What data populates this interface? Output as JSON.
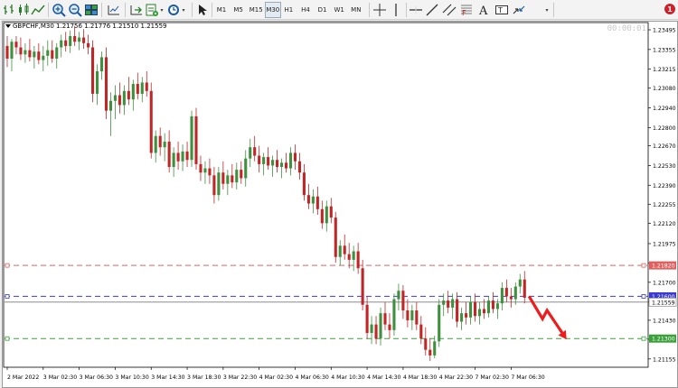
{
  "toolbar": {
    "timeframes": [
      "M1",
      "M5",
      "M15",
      "M30",
      "H1",
      "H4",
      "D1",
      "W1",
      "MN"
    ],
    "active_timeframe": "M30",
    "notification_count": "1",
    "icons": [
      "bar-chart-icon",
      "candlestick-icon",
      "line-chart-icon",
      "zoom-in-icon",
      "zoom-out-icon",
      "tile-windows-icon",
      "chart-shift-icon",
      "autoscroll-icon",
      "templates-icon",
      "periods-icon",
      "cursor-icon",
      "crosshair-icon",
      "vertical-line-icon",
      "horizontal-line-icon",
      "trendline-icon",
      "equidistant-channel-icon",
      "fibonacci-icon",
      "text-icon",
      "text-label-icon",
      "arrows-icon"
    ]
  },
  "chart": {
    "title": "GBPCHF,M30  1.21756 1.21776 1.21510 1.21559",
    "timer": "00:00:01"
  },
  "chart_data": {
    "type": "candlestick",
    "symbol": "GBPCHF",
    "timeframe": "M30",
    "ylim": [
      1.21096,
      1.2354
    ],
    "yticks": [
      1.23495,
      1.23355,
      1.23215,
      1.2308,
      1.2294,
      1.228,
      1.2267,
      1.2253,
      1.2239,
      1.22255,
      1.2212,
      1.21975,
      1.21835,
      1.217,
      1.2156,
      1.2143,
      1.21295,
      1.21155
    ],
    "ytick_labels": [
      "1.23495",
      "1.23355",
      "1.23215",
      "1.23080",
      "1.22940",
      "1.22800",
      "1.22670",
      "1.22530",
      "1.22390",
      "1.22255",
      "1.22120",
      "1.21975",
      "1.21835",
      "1.21700",
      "1.21560",
      "1.21430",
      "1.21295",
      "1.21155"
    ],
    "xtick_labels": [
      "2 Mar 2022",
      "3 Mar 02:30",
      "3 Mar 06:30",
      "3 Mar 10:30",
      "3 Mar 14:30",
      "3 Mar 18:30",
      "3 Mar 22:30",
      "4 Mar 02:30",
      "4 Mar 06:30",
      "4 Mar 10:30",
      "4 Mar 14:30",
      "4 Mar 18:30",
      "4 Mar 22:30",
      "7 Mar 02:30",
      "7 Mar 06:30"
    ],
    "xtick_bar_index": [
      0,
      8,
      16,
      24,
      32,
      40,
      48,
      56,
      64,
      72,
      80,
      88,
      96,
      104,
      112
    ],
    "bar_index_of_last": 126,
    "candles": [
      [
        1.2338,
        1.2345,
        1.2323,
        1.2329
      ],
      [
        1.2329,
        1.2343,
        1.232,
        1.2341
      ],
      [
        1.2341,
        1.2345,
        1.2332,
        1.2337
      ],
      [
        1.2337,
        1.2344,
        1.2328,
        1.2332
      ],
      [
        1.2332,
        1.234,
        1.2326,
        1.2335
      ],
      [
        1.2335,
        1.2343,
        1.2327,
        1.233
      ],
      [
        1.233,
        1.2338,
        1.2322,
        1.2334
      ],
      [
        1.2334,
        1.234,
        1.2325,
        1.2328
      ],
      [
        1.2328,
        1.2338,
        1.232,
        1.2331
      ],
      [
        1.2331,
        1.2342,
        1.2324,
        1.2335
      ],
      [
        1.2335,
        1.2342,
        1.2326,
        1.2329
      ],
      [
        1.2329,
        1.234,
        1.2322,
        1.2337
      ],
      [
        1.2337,
        1.2346,
        1.233,
        1.2342
      ],
      [
        1.2342,
        1.2348,
        1.2334,
        1.2338
      ],
      [
        1.2338,
        1.2349,
        1.2333,
        1.2345
      ],
      [
        1.2345,
        1.2352,
        1.2338,
        1.2341
      ],
      [
        1.2341,
        1.2348,
        1.2335,
        1.2344
      ],
      [
        1.2344,
        1.235,
        1.2336,
        1.234
      ],
      [
        1.234,
        1.2346,
        1.2332,
        1.2337
      ],
      [
        1.2337,
        1.2342,
        1.2298,
        1.2304
      ],
      [
        1.2304,
        1.2325,
        1.2296,
        1.232
      ],
      [
        1.232,
        1.2334,
        1.2314,
        1.233
      ],
      [
        1.233,
        1.2337,
        1.2286,
        1.2292
      ],
      [
        1.2292,
        1.2305,
        1.2274,
        1.2299
      ],
      [
        1.2299,
        1.231,
        1.2286,
        1.2303
      ],
      [
        1.2303,
        1.2312,
        1.229,
        1.2296
      ],
      [
        1.2296,
        1.231,
        1.2289,
        1.2306
      ],
      [
        1.2306,
        1.2316,
        1.2296,
        1.23
      ],
      [
        1.23,
        1.2314,
        1.2292,
        1.2311
      ],
      [
        1.2311,
        1.2319,
        1.23,
        1.2304
      ],
      [
        1.2304,
        1.2316,
        1.2298,
        1.2312
      ],
      [
        1.2312,
        1.232,
        1.2302,
        1.2306
      ],
      [
        1.2306,
        1.2312,
        1.2258,
        1.2262
      ],
      [
        1.2262,
        1.2278,
        1.2255,
        1.2274
      ],
      [
        1.2274,
        1.228,
        1.226,
        1.2266
      ],
      [
        1.2266,
        1.2276,
        1.2256,
        1.227
      ],
      [
        1.227,
        1.2278,
        1.2248,
        1.2252
      ],
      [
        1.2252,
        1.2266,
        1.2245,
        1.2262
      ],
      [
        1.2262,
        1.227,
        1.225,
        1.2256
      ],
      [
        1.2256,
        1.2268,
        1.2249,
        1.2263
      ],
      [
        1.2263,
        1.227,
        1.2252,
        1.2257
      ],
      [
        1.2257,
        1.2292,
        1.2252,
        1.2288
      ],
      [
        1.2288,
        1.2294,
        1.225,
        1.2254
      ],
      [
        1.2254,
        1.226,
        1.2242,
        1.2248
      ],
      [
        1.2248,
        1.2256,
        1.224,
        1.2251
      ],
      [
        1.2251,
        1.2258,
        1.224,
        1.2246
      ],
      [
        1.2246,
        1.2252,
        1.2226,
        1.2232
      ],
      [
        1.2232,
        1.2252,
        1.2228,
        1.2248
      ],
      [
        1.2248,
        1.2256,
        1.2236,
        1.224
      ],
      [
        1.224,
        1.225,
        1.2232,
        1.2246
      ],
      [
        1.2246,
        1.2254,
        1.2237,
        1.2241
      ],
      [
        1.2241,
        1.2255,
        1.2236,
        1.225
      ],
      [
        1.225,
        1.2256,
        1.224,
        1.2244
      ],
      [
        1.2244,
        1.2264,
        1.2238,
        1.2258
      ],
      [
        1.2258,
        1.2272,
        1.2252,
        1.2266
      ],
      [
        1.2266,
        1.2274,
        1.2256,
        1.226
      ],
      [
        1.226,
        1.2267,
        1.2248,
        1.2254
      ],
      [
        1.2254,
        1.2262,
        1.2246,
        1.2259
      ],
      [
        1.2259,
        1.2266,
        1.225,
        1.2253
      ],
      [
        1.2253,
        1.226,
        1.2245,
        1.2257
      ],
      [
        1.2257,
        1.2264,
        1.2248,
        1.2252
      ],
      [
        1.2252,
        1.2258,
        1.2244,
        1.2255
      ],
      [
        1.2255,
        1.2262,
        1.2248,
        1.2251
      ],
      [
        1.2251,
        1.2266,
        1.2246,
        1.2262
      ],
      [
        1.2262,
        1.2268,
        1.225,
        1.2256
      ],
      [
        1.2256,
        1.2262,
        1.2243,
        1.2248
      ],
      [
        1.2248,
        1.2254,
        1.2228,
        1.2232
      ],
      [
        1.2232,
        1.224,
        1.2222,
        1.2226
      ],
      [
        1.2226,
        1.2236,
        1.2219,
        1.2231
      ],
      [
        1.2231,
        1.2238,
        1.2218,
        1.2222
      ],
      [
        1.2222,
        1.2228,
        1.2208,
        1.2212
      ],
      [
        1.2212,
        1.2228,
        1.2206,
        1.2224
      ],
      [
        1.2224,
        1.223,
        1.2212,
        1.2216
      ],
      [
        1.2216,
        1.222,
        1.2184,
        1.2188
      ],
      [
        1.2188,
        1.22,
        1.2182,
        1.2196
      ],
      [
        1.2196,
        1.2204,
        1.2186,
        1.219
      ],
      [
        1.219,
        1.2198,
        1.218,
        1.2186
      ],
      [
        1.2186,
        1.2196,
        1.2178,
        1.2192
      ],
      [
        1.2192,
        1.2198,
        1.2176,
        1.218
      ],
      [
        1.218,
        1.2186,
        1.215,
        1.2154
      ],
      [
        1.2154,
        1.216,
        1.213,
        1.2134
      ],
      [
        1.2134,
        1.2146,
        1.2126,
        1.214
      ],
      [
        1.214,
        1.2146,
        1.2126,
        1.213
      ],
      [
        1.213,
        1.2152,
        1.2125,
        1.2148
      ],
      [
        1.2148,
        1.2156,
        1.2136,
        1.214
      ],
      [
        1.214,
        1.2148,
        1.213,
        1.2136
      ],
      [
        1.2136,
        1.2162,
        1.2132,
        1.2158
      ],
      [
        1.2158,
        1.2169,
        1.215,
        1.2164
      ],
      [
        1.2164,
        1.2168,
        1.2144,
        1.215
      ],
      [
        1.215,
        1.2158,
        1.2138,
        1.2143
      ],
      [
        1.2143,
        1.2154,
        1.2136,
        1.215
      ],
      [
        1.215,
        1.2156,
        1.2136,
        1.214
      ],
      [
        1.214,
        1.2146,
        1.2126,
        1.213
      ],
      [
        1.213,
        1.2138,
        1.2118,
        1.2122
      ],
      [
        1.2122,
        1.213,
        1.2114,
        1.2118
      ],
      [
        1.2118,
        1.2132,
        1.2116,
        1.2128
      ],
      [
        1.2128,
        1.2158,
        1.2124,
        1.2154
      ],
      [
        1.2154,
        1.2162,
        1.2146,
        1.2157
      ],
      [
        1.2157,
        1.2164,
        1.2148,
        1.2152
      ],
      [
        1.2152,
        1.2162,
        1.2144,
        1.2158
      ],
      [
        1.2158,
        1.2163,
        1.2138,
        1.2142
      ],
      [
        1.2142,
        1.2152,
        1.2136,
        1.2148
      ],
      [
        1.2148,
        1.2156,
        1.214,
        1.2145
      ],
      [
        1.2145,
        1.216,
        1.214,
        1.2156
      ],
      [
        1.2156,
        1.2162,
        1.2142,
        1.2146
      ],
      [
        1.2146,
        1.2156,
        1.214,
        1.2151
      ],
      [
        1.2151,
        1.2158,
        1.2144,
        1.2148
      ],
      [
        1.2148,
        1.216,
        1.2145,
        1.2157
      ],
      [
        1.2157,
        1.2163,
        1.2148,
        1.2151
      ],
      [
        1.2151,
        1.2158,
        1.2144,
        1.2155
      ],
      [
        1.2155,
        1.217,
        1.215,
        1.2166
      ],
      [
        1.2166,
        1.2172,
        1.2156,
        1.216
      ],
      [
        1.216,
        1.2166,
        1.2152,
        1.2158
      ],
      [
        1.2158,
        1.217,
        1.2154,
        1.2167
      ],
      [
        1.2167,
        1.2176,
        1.2162,
        1.2172
      ],
      [
        1.2172,
        1.2178,
        1.2155,
        1.2159
      ]
    ],
    "hlines": [
      {
        "price": 1.2182,
        "label": "1.21820",
        "color": "#e06060",
        "style": "dashed"
      },
      {
        "price": 1.216,
        "label": "1.21600",
        "color": "#3a3ad0",
        "style": "dashed"
      },
      {
        "price": 1.21559,
        "label": "1.21559",
        "color": "#7a7a7a",
        "style": "solid"
      },
      {
        "price": 1.213,
        "label": "1.21300",
        "color": "#3aa03a",
        "style": "dashed"
      }
    ],
    "bull_color": "#3f8f3f",
    "bear_color": "#c02626",
    "arrow_color": "#ee1c1c",
    "arrow_points": [
      [
        1.216,
        1
      ],
      [
        1.2144,
        4
      ],
      [
        1.215,
        5
      ],
      [
        1.2131,
        9
      ]
    ]
  }
}
